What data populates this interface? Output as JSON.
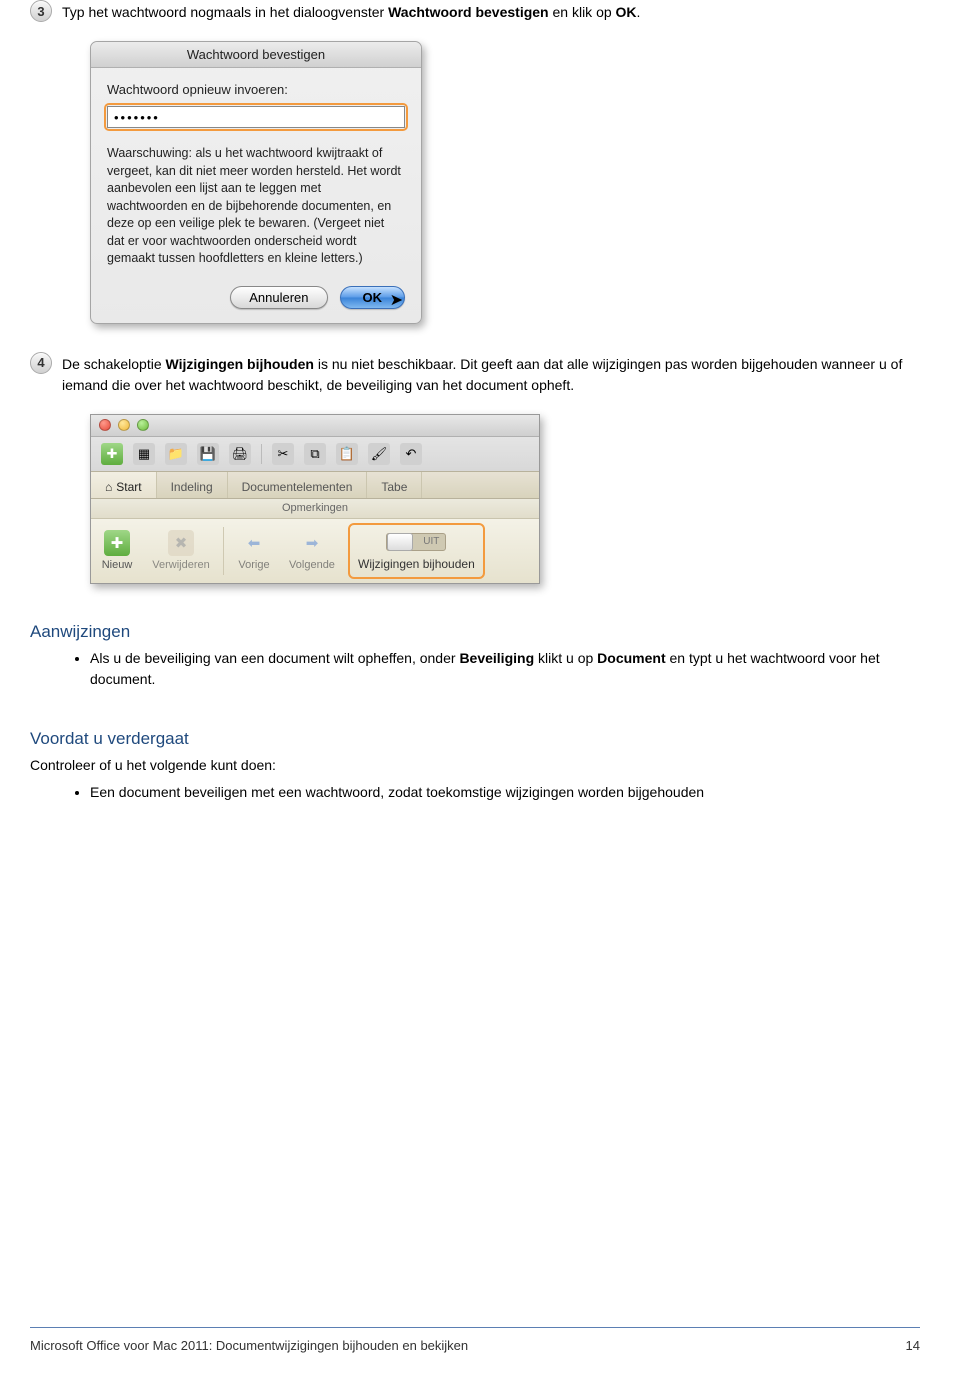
{
  "step3": {
    "number": "3",
    "text_a": "Typ het wachtwoord nogmaals in het dialoogvenster ",
    "bold1": "Wachtwoord bevestigen",
    "text_b": " en klik op ",
    "bold2": "OK",
    "text_c": "."
  },
  "pw_dialog": {
    "title": "Wachtwoord bevestigen",
    "label": "Wachtwoord opnieuw invoeren:",
    "value": "•••••••",
    "warning": "Waarschuwing: als u het wachtwoord kwijtraakt of vergeet, kan dit niet meer worden hersteld. Het wordt aanbevolen een lijst aan te leggen met wachtwoorden en de bijbehorende documenten, en deze op een veilige plek te bewaren. (Vergeet niet dat er voor wachtwoorden onderscheid wordt gemaakt tussen hoofdletters en kleine letters.)",
    "cancel": "Annuleren",
    "ok": "OK"
  },
  "step4": {
    "number": "4",
    "text_a": "De schakeloptie ",
    "bold1": "Wijzigingen bijhouden",
    "text_b": " is nu niet beschikbaar. Dit geeft aan dat alle wijzigingen pas worden bijgehouden wanneer u of iemand die over het wachtwoord beschikt, de beveiliging van het document opheft."
  },
  "ribbon": {
    "tabs": {
      "start": "Start",
      "indeling": "Indeling",
      "docelem": "Documentelementen",
      "tabe": "Tabe"
    },
    "home_icon": "⌂",
    "group_label": "Opmerkingen",
    "items": {
      "nieuw": "Nieuw",
      "verwijderen": "Verwijderen",
      "vorige": "Vorige",
      "volgende": "Volgende"
    },
    "wijz_label": "Wijzigingen bijhouden",
    "toggle_uit": "UIT"
  },
  "hints": {
    "title": "Aanwijzingen",
    "bullet_a": "Als u de beveiliging van een document wilt opheffen, onder ",
    "bullet_bold1": "Beveiliging",
    "bullet_b": " klikt u op ",
    "bullet_bold2": "Document",
    "bullet_c": " en typt u het wachtwoord voor het document."
  },
  "before": {
    "title": "Voordat u verdergaat",
    "lead": "Controleer of u het volgende kunt doen:",
    "bullet": "Een document beveiligen met een wachtwoord, zodat toekomstige wijzigingen worden bijgehouden"
  },
  "footer": {
    "left": "Microsoft Office voor Mac 2011: Documentwijzigingen bijhouden en bekijken",
    "right": "14"
  }
}
